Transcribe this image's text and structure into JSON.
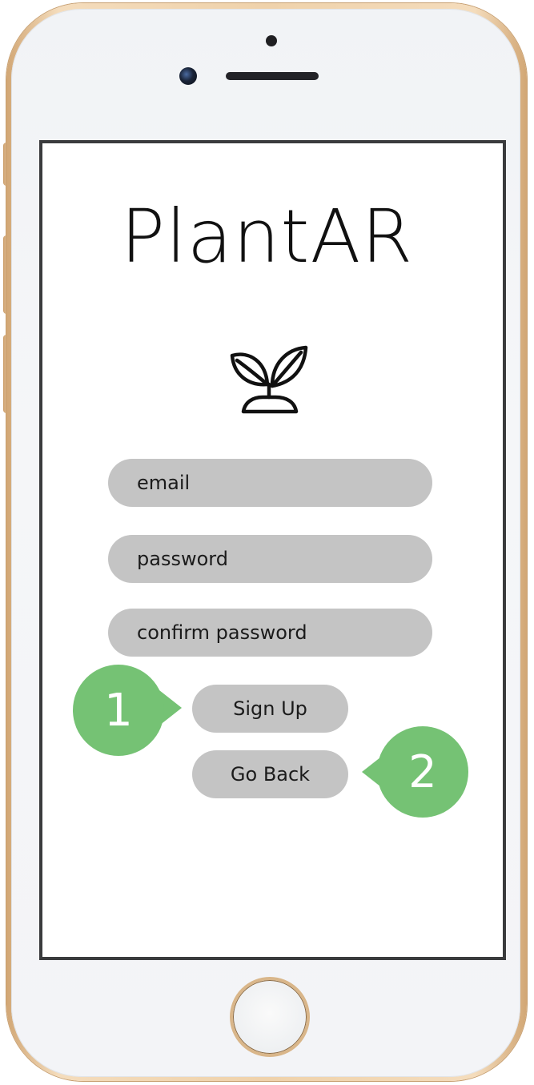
{
  "app": {
    "title": "PlantAR",
    "logo_icon": "sprout-icon"
  },
  "signup_form": {
    "email_placeholder": "email",
    "password_placeholder": "password",
    "confirm_password_placeholder": "confirm password"
  },
  "actions": {
    "sign_up_label": "Sign Up",
    "go_back_label": "Go Back"
  },
  "annotations": [
    {
      "number": "1",
      "target": "Sign Up"
    },
    {
      "number": "2",
      "target": "Go Back"
    }
  ],
  "colors": {
    "field_background": "#c4c4c4",
    "annotation_green": "#75c274",
    "screen_border": "#3a3b3d",
    "phone_gold": "#efd2ab"
  }
}
